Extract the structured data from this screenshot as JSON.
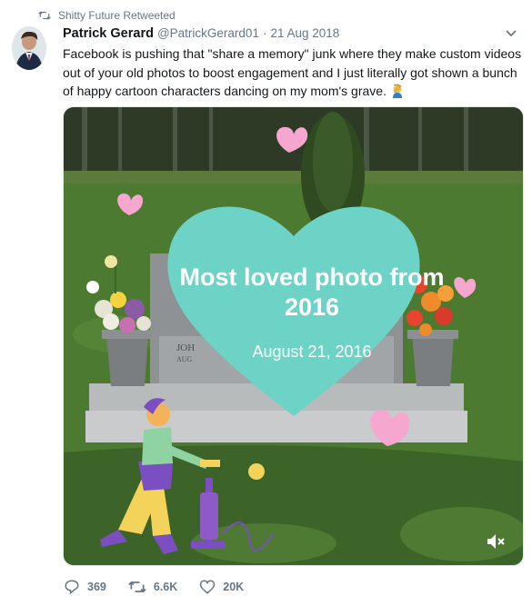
{
  "retweet": {
    "label": "Shitty Future Retweeted",
    "icon": "retweet-icon"
  },
  "tweet": {
    "display_name": "Patrick Gerard",
    "handle": "@PatrickGerard01",
    "separator": "·",
    "date": "21 Aug 2018",
    "text": "Facebook is pushing that \"share a memory\" junk where they make custom videos out of your old photos to boost engagement and I just literally got shown a bunch of happy cartoon characters dancing on my mom's grave.",
    "emoji": "facepalm-emoji"
  },
  "media": {
    "heart_title": "Most loved photo from 2016",
    "heart_date": "August 21, 2016",
    "stone_text": "JOH\nAUG",
    "mute_icon": "muted-speaker-icon",
    "colors": {
      "heart": "#6cd3c6",
      "pink": "#f6a7cf",
      "grass": "#3f6a2a",
      "stone": "#8f9294"
    }
  },
  "actions": {
    "replies": "369",
    "retweets": "6.6K",
    "likes": "20K"
  }
}
